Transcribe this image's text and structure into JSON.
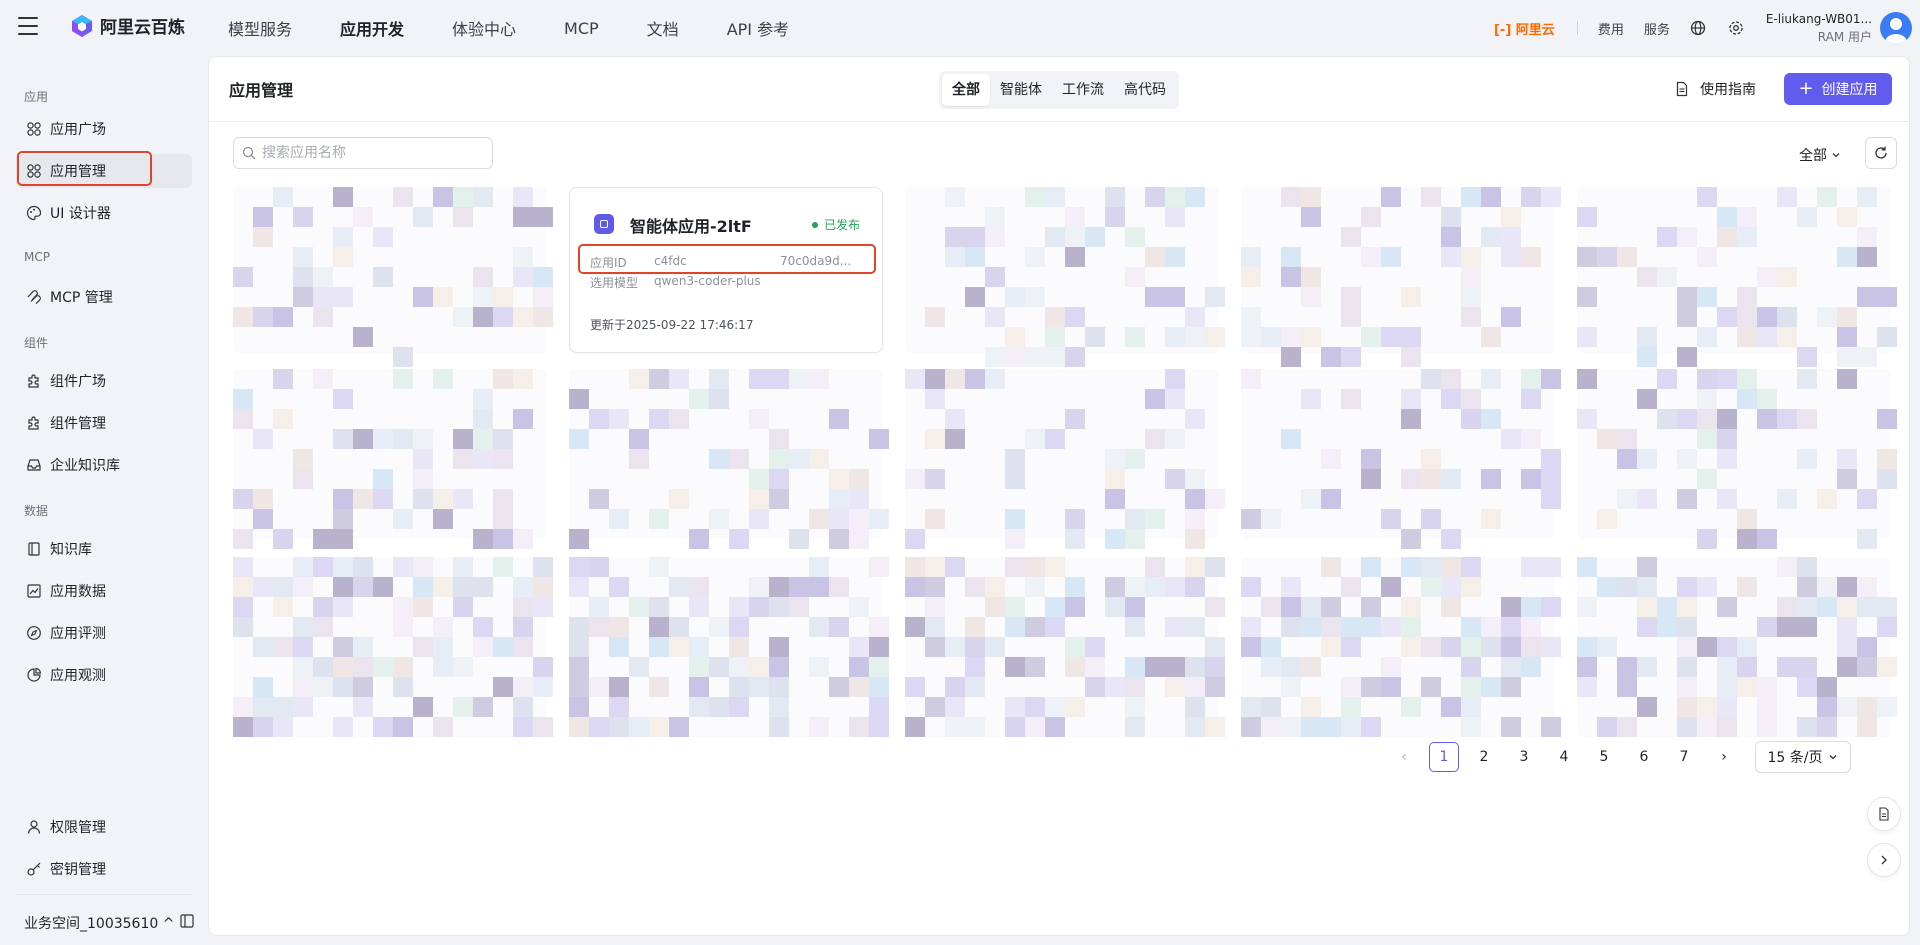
{
  "topbar": {
    "brand": "阿里云百炼",
    "nav": [
      "模型服务",
      "应用开发",
      "体验中心",
      "MCP",
      "文档",
      "API 参考"
    ],
    "active_nav": "应用开发",
    "aliyun_label": "阿里云",
    "fee_label": "费用",
    "service_label": "服务",
    "user_name": "E-liukang-WB01...",
    "user_role": "RAM 用户"
  },
  "sidebar": {
    "group_app": "应用",
    "item_app_plaza": "应用广场",
    "item_app_manage": "应用管理",
    "item_ui_designer": "UI 设计器",
    "group_mcp": "MCP",
    "item_mcp_manage": "MCP 管理",
    "group_component": "组件",
    "item_component_plaza": "组件广场",
    "item_component_manage": "组件管理",
    "item_enterprise_kb": "企业知识库",
    "group_data": "数据",
    "item_kb": "知识库",
    "item_app_data": "应用数据",
    "item_app_eval": "应用评测",
    "item_app_observe": "应用观测",
    "item_permission": "权限管理",
    "item_key": "密钥管理",
    "workspace": "业务空间_10035610"
  },
  "main": {
    "title": "应用管理",
    "tabs": [
      "全部",
      "智能体",
      "工作流",
      "高代码"
    ],
    "active_tab": "全部",
    "guide_label": "使用指南",
    "create_label": "创建应用",
    "search_placeholder": "搜索应用名称",
    "filter_label": "全部"
  },
  "card": {
    "name": "智能体应用-2ltF",
    "status": "已发布",
    "id_label": "应用ID",
    "id_value_start": "c4fdc",
    "id_value_end": "70c0da9d...",
    "model_label": "选用模型",
    "model_value": "qwen3-coder-plus",
    "updated": "更新于2025-09-22 17:46:17"
  },
  "pagination": {
    "pages": [
      "1",
      "2",
      "3",
      "4",
      "5",
      "6",
      "7"
    ],
    "current": "1",
    "page_size": "15 条/页"
  },
  "colors": {
    "accent": "#615ced",
    "highlight_red": "#e0452b",
    "published_green": "#22a55a",
    "brand_orange": "#ff6a00"
  }
}
